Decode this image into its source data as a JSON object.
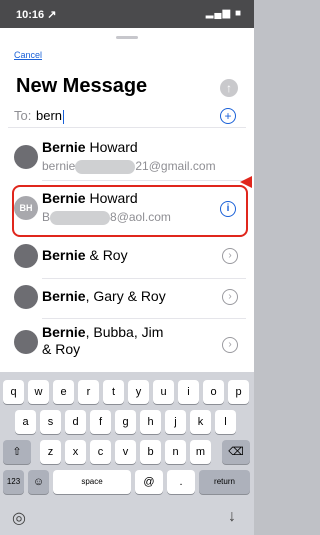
{
  "status_bar": {
    "time": "10:16 ↗",
    "icons": "▂▄▆ ■"
  },
  "header": {
    "cancel": "Cancel",
    "title": "New Message",
    "send_icon": "arrow-up-icon"
  },
  "to_field": {
    "label": "To:",
    "value": "bern",
    "add_icon": "plus-circle-icon"
  },
  "contacts": [
    {
      "initials": "",
      "name_bold": "Bernie",
      "name_rest": " Howard",
      "sub_prefix": "bernie",
      "sub_suffix": "21@gmail.com",
      "action": "none"
    },
    {
      "initials": "BH",
      "name_bold": "Bernie",
      "name_rest": " Howard",
      "sub_prefix": "B",
      "sub_suffix": "8@aol.com",
      "action": "info"
    },
    {
      "initials": "",
      "name_bold": "Bernie",
      "name_rest": " & Roy",
      "action": "chevron"
    },
    {
      "initials": "",
      "name_bold": "Bernie",
      "name_rest": ", Gary & Roy",
      "action": "chevron"
    },
    {
      "initials": "",
      "name_bold": "Bernie",
      "name_rest": ", Bubba, Jim",
      "name_line2": "& Roy",
      "action": "chevron"
    }
  ],
  "keyboard": {
    "row1": [
      "q",
      "w",
      "e",
      "r",
      "t",
      "y",
      "u",
      "i",
      "o",
      "p"
    ],
    "row2": [
      "a",
      "s",
      "d",
      "f",
      "g",
      "h",
      "j",
      "k",
      "l"
    ],
    "row3": [
      "z",
      "x",
      "c",
      "v",
      "b",
      "n",
      "m"
    ],
    "shift": "⇧",
    "delete": "⌫",
    "numbers": "123",
    "emoji": "☺",
    "space": "space",
    "at": "@",
    "dot": ".",
    "return": "return",
    "globe": "◎",
    "mic": "↓"
  },
  "colors": {
    "accent": "#1a61d8",
    "highlight": "#e0261c"
  }
}
